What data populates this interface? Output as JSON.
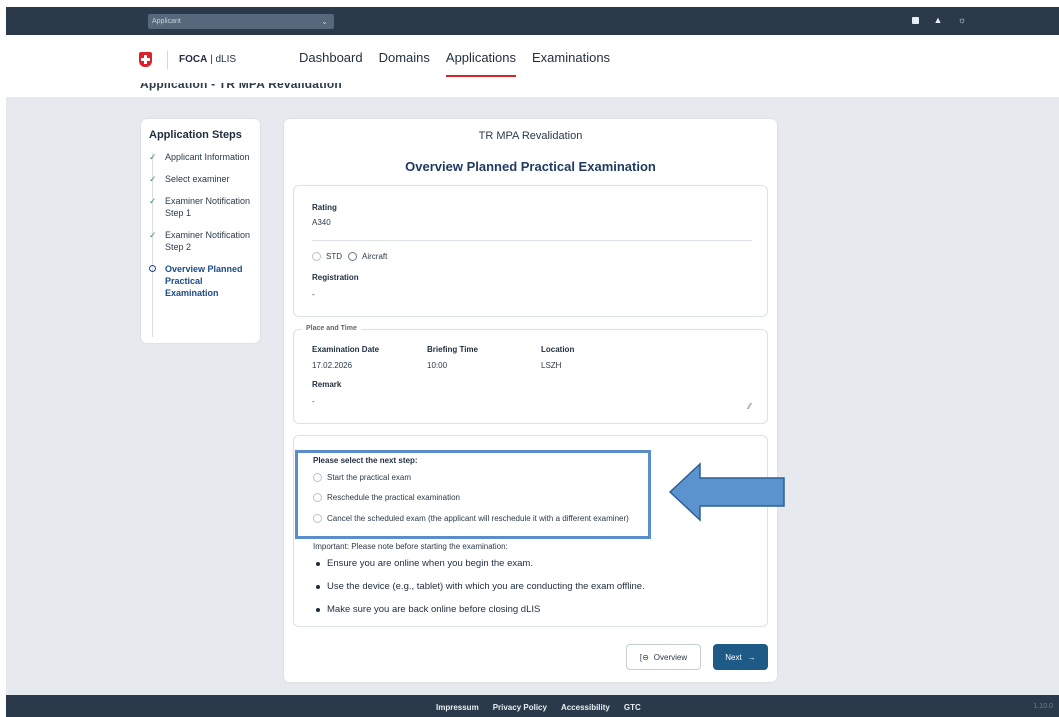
{
  "topbar": {
    "role_select": "Applicant",
    "icons": [
      "help-icon",
      "user-icon",
      "theme-toggle-icon"
    ]
  },
  "nav": {
    "brand_strong": "FOCA",
    "brand_rest": " | dLIS",
    "items": [
      "Dashboard",
      "Domains",
      "Applications",
      "Examinations"
    ],
    "active": "Applications"
  },
  "subhead": {
    "text": "Application - TR MPA Revalidation"
  },
  "steps": {
    "title": "Application Steps",
    "items": [
      {
        "label": "Applicant Information",
        "state": "done"
      },
      {
        "label": "Select examiner",
        "state": "done"
      },
      {
        "label": "Examiner Notification Step 1",
        "state": "done"
      },
      {
        "label": "Examiner Notification Step 2",
        "state": "done"
      },
      {
        "label": "Overview Planned Practical Examination",
        "state": "current"
      }
    ]
  },
  "main": {
    "subtitle": "TR MPA Revalidation",
    "title": "Overview Planned Practical Examination",
    "rating": {
      "label": "Rating",
      "value": "A340",
      "radio_std": "STD",
      "radio_aircraft": "Aircraft",
      "registration_label": "Registration",
      "registration_value": "-"
    },
    "place": {
      "legend": "Place and Time",
      "date_label": "Examination Date",
      "date_value": "17.02.2026",
      "briefing_label": "Briefing Time",
      "briefing_value": "10:00",
      "location_label": "Location",
      "location_value": "LSZH",
      "remark_label": "Remark",
      "remark_value": "-"
    },
    "next_step": {
      "heading": "Please select the next step:",
      "options": [
        "Start the practical exam",
        "Reschedule the practical examination",
        "Cancel the scheduled exam (the applicant will reschedule it with a different examiner)"
      ],
      "important": "Important: Please note before starting the examination:",
      "bullets": [
        "Ensure you are online when you begin the exam.",
        "Use the device (e.g., tablet) with which you are conducting the exam offline.",
        "Make sure you are back online before closing dLIS"
      ]
    },
    "buttons": {
      "overview": "Overview",
      "next": "Next"
    }
  },
  "footer": {
    "links": [
      "Impressum",
      "Privacy Policy",
      "Accessibility",
      "GTC"
    ],
    "version": "1.10.0"
  },
  "colors": {
    "topbar": "#2b3a4a",
    "accent_red": "#d8232a",
    "primary_blue": "#1e5a86",
    "highlight_blue": "#5a8ec8"
  }
}
